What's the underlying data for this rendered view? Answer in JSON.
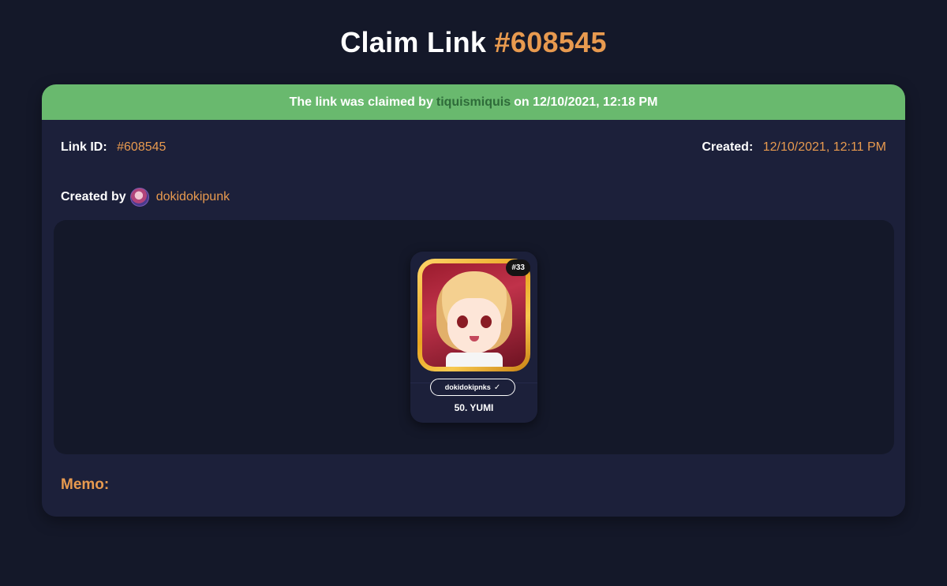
{
  "header": {
    "title_prefix": "Claim Link",
    "title_id": "#608545"
  },
  "banner": {
    "text_before": "The link was claimed by",
    "claimer": "tiquismiquis",
    "text_after": "on 12/10/2021, 12:18 PM"
  },
  "details": {
    "link_id_label": "Link ID:",
    "link_id_value": "#608545",
    "created_label": "Created:",
    "created_value": "12/10/2021, 12:11 PM",
    "created_by_label": "Created by",
    "creator": "dokidokipunk"
  },
  "nft": {
    "number": "#33",
    "collection": "dokidokipnks",
    "name": "50. YUMI"
  },
  "memo": {
    "label": "Memo:"
  }
}
